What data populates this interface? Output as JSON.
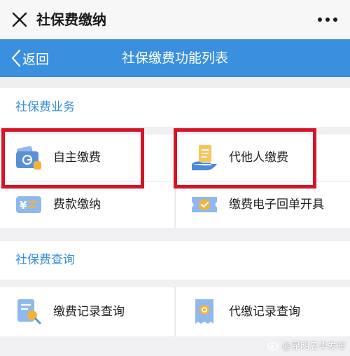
{
  "window": {
    "title": "社保费缴纳"
  },
  "nav": {
    "back_label": "返回",
    "title": "社保缴费功能列表"
  },
  "sections": [
    {
      "title": "社保费业务"
    },
    {
      "title": "社保费查询"
    }
  ],
  "items": [
    {
      "label": "自主缴费"
    },
    {
      "label": "代他人缴费"
    },
    {
      "label": "费款缴纳"
    },
    {
      "label": "缴费电子回单开具"
    },
    {
      "label": "缴费记录查询"
    },
    {
      "label": "代缴记录查询"
    }
  ],
  "watermark": {
    "text": "@昆明五华发布"
  },
  "colors": {
    "accent": "#3a8fde",
    "highlight": "#d51427"
  }
}
